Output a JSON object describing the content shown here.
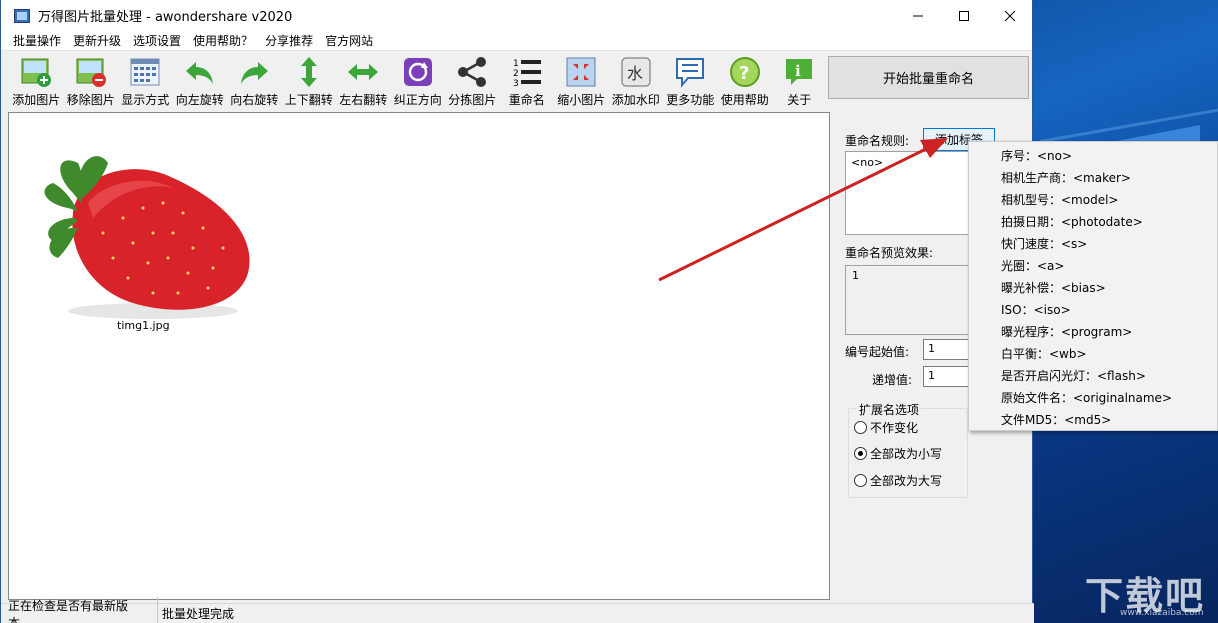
{
  "window": {
    "title": "万得图片批量处理 - awondershare v2020"
  },
  "menu": [
    "批量操作",
    "更新升级",
    "选项设置",
    "使用帮助？",
    "分享推荐",
    "官方网站"
  ],
  "toolbar": [
    {
      "label": "添加图片",
      "icon": "add-image-icon"
    },
    {
      "label": "移除图片",
      "icon": "remove-image-icon"
    },
    {
      "label": "显示方式",
      "icon": "grid-view-icon"
    },
    {
      "label": "向左旋转",
      "icon": "rotate-left-icon"
    },
    {
      "label": "向右旋转",
      "icon": "rotate-right-icon"
    },
    {
      "label": "上下翻转",
      "icon": "flip-vertical-icon"
    },
    {
      "label": "左右翻转",
      "icon": "flip-horizontal-icon"
    },
    {
      "label": "纠正方向",
      "icon": "correct-orientation-icon"
    },
    {
      "label": "分拣图片",
      "icon": "share-sort-icon"
    },
    {
      "label": "重命名",
      "icon": "numbered-list-icon"
    },
    {
      "label": "缩小图片",
      "icon": "shrink-icon"
    },
    {
      "label": "添加水印",
      "icon": "watermark-icon"
    },
    {
      "label": "更多功能",
      "icon": "more-chat-icon"
    },
    {
      "label": "使用帮助",
      "icon": "help-icon"
    },
    {
      "label": "关于",
      "icon": "info-icon"
    }
  ],
  "start_button": "开始批量重命名",
  "thumbnail": {
    "caption": "timg1.jpg"
  },
  "panel": {
    "rule_label": "重命名规则:",
    "add_tag": "添加标签",
    "rule_value": "<no>",
    "preview_label": "重命名预览效果:",
    "preview_value": "1",
    "start_label": "编号起始值:",
    "start_value": "1",
    "inc_label": "递增值:",
    "inc_value": "1",
    "ext_legend": "扩展名选项",
    "ext_options": [
      "不作变化",
      "全部改为小写",
      "全部改为大写"
    ],
    "ext_selected": 1
  },
  "tag_menu": [
    "序号：<no>",
    "相机生产商：<maker>",
    "相机型号：<model>",
    "拍摄日期：<photodate>",
    "快门速度：<s>",
    "光圈：<a>",
    "曝光补偿：<bias>",
    "ISO：<iso>",
    "曝光程序：<program>",
    "白平衡：<wb>",
    "是否开启闪光灯：<flash>",
    "原始文件名：<originalname>",
    "文件MD5：<md5>"
  ],
  "status": {
    "left": "正在检查是否有最新版本.....",
    "right": "批量处理完成"
  },
  "watermark": {
    "text": "下载吧",
    "url": "www.xiazaiba.com"
  },
  "colors": {
    "arrow": "#cc2222",
    "accent": "#0078d7"
  }
}
